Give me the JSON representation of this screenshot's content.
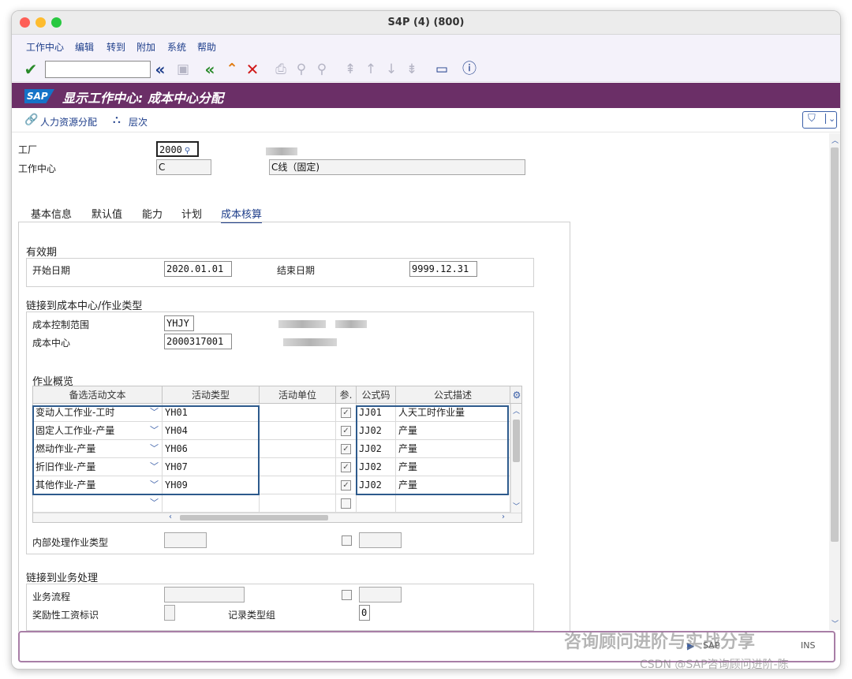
{
  "window": {
    "title": "S4P (4) (800)"
  },
  "menu": [
    "工作中心",
    "编辑",
    "转到",
    "附加",
    "系统",
    "帮助"
  ],
  "toolbar": {
    "command_value": "",
    "icons": [
      "check-icon",
      "back-icon",
      "save-icon",
      "first-page-icon",
      "prev-icon",
      "cancel-icon",
      "print-icon",
      "find-icon",
      "find-next-icon",
      "page-first-icon",
      "page-prev-icon",
      "page-next-icon",
      "page-last-icon",
      "layout-icon",
      "help-icon"
    ]
  },
  "app": {
    "logo": "SAP",
    "title": "显示工作中心: 成本中心分配"
  },
  "app_functions": {
    "hr_assign": "人力资源分配",
    "hierarchy": "层次"
  },
  "header": {
    "plant_label": "工厂",
    "plant_value": "2000",
    "workcenter_label": "工作中心",
    "workcenter_value": "C",
    "workcenter_desc": "C线（固定)"
  },
  "tabs": [
    {
      "label": "基本信息",
      "active": false
    },
    {
      "label": "默认值",
      "active": false
    },
    {
      "label": "能力",
      "active": false
    },
    {
      "label": "计划",
      "active": false
    },
    {
      "label": "成本核算",
      "active": true
    }
  ],
  "validity": {
    "title": "有效期",
    "start_label": "开始日期",
    "start_value": "2020.01.01",
    "end_label": "结束日期",
    "end_value": "9999.12.31"
  },
  "link_cc": {
    "title": "链接到成本中心/作业类型",
    "area_label": "成本控制范围",
    "area_value": "YHJY",
    "cc_label": "成本中心",
    "cc_value": "2000317001"
  },
  "activity": {
    "title": "作业概览",
    "columns": [
      "备选活动文本",
      "活动类型",
      "活动单位",
      "参.",
      "公式码",
      "公式描述"
    ],
    "rows": [
      {
        "text": "变动人工作业-工时",
        "type": "YH01",
        "unit": "",
        "ref": true,
        "formula": "JJ01",
        "desc": "人天工时作业量"
      },
      {
        "text": "固定人工作业-产量",
        "type": "YH04",
        "unit": "",
        "ref": true,
        "formula": "JJ02",
        "desc": "产量"
      },
      {
        "text": "燃动作业-产量",
        "type": "YH06",
        "unit": "",
        "ref": true,
        "formula": "JJ02",
        "desc": "产量"
      },
      {
        "text": "折旧作业-产量",
        "type": "YH07",
        "unit": "",
        "ref": true,
        "formula": "JJ02",
        "desc": "产量"
      },
      {
        "text": "其他作业-产量",
        "type": "YH09",
        "unit": "",
        "ref": true,
        "formula": "JJ02",
        "desc": "产量"
      },
      {
        "text": "",
        "type": "",
        "unit": "",
        "ref": false,
        "formula": "",
        "desc": ""
      }
    ],
    "internal_label": "内部处理作业类型"
  },
  "link_biz": {
    "title": "链接到业务处理",
    "process_label": "业务流程",
    "incentive_label": "奖励性工资标识",
    "record_label": "记录类型组",
    "record_value": "0"
  },
  "status": {
    "sap_label": "SAP",
    "ins_label": "INS"
  },
  "watermark": {
    "line1": "咨询顾问进阶与实战分享",
    "line2": "CSDN @SAP咨询顾问进阶-陈"
  }
}
